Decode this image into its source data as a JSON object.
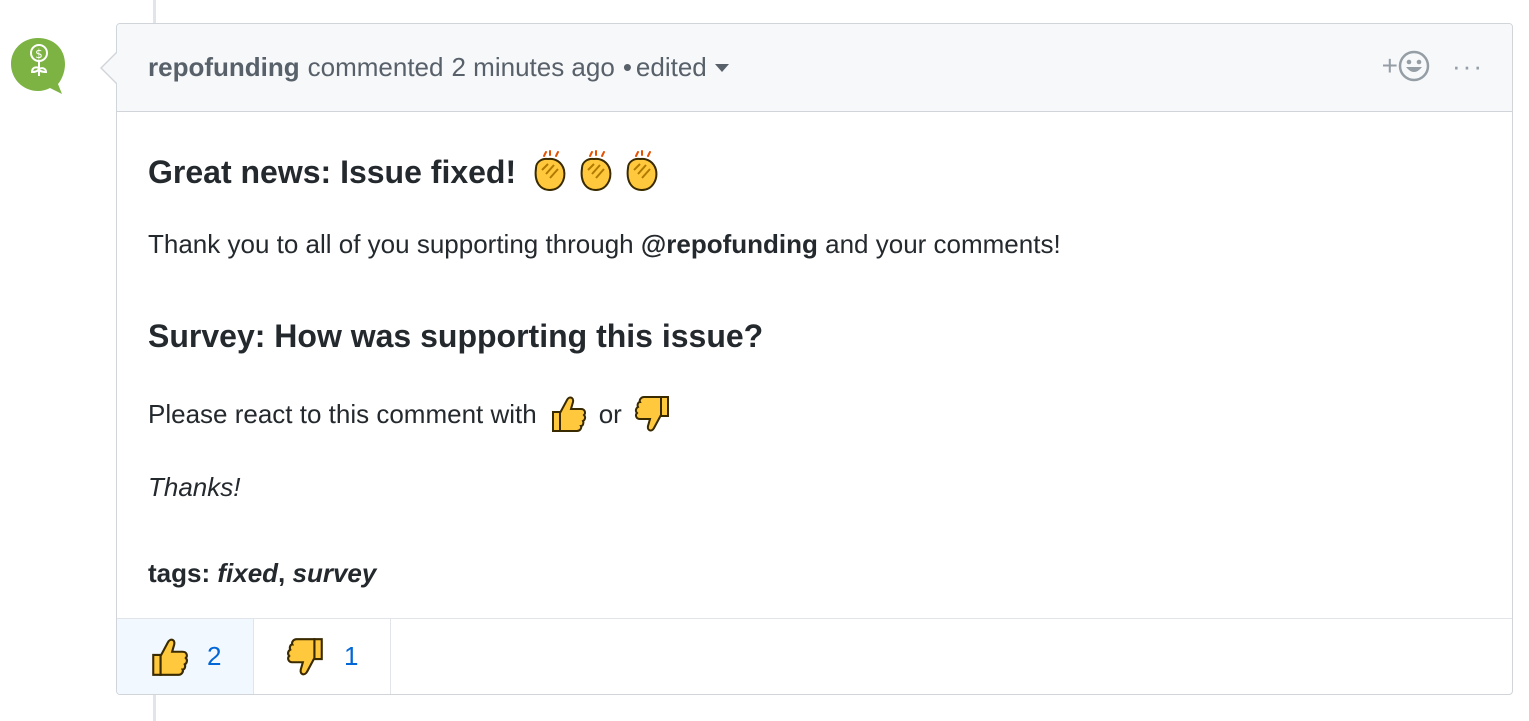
{
  "comment": {
    "author": "repofunding",
    "action": "commented",
    "time": "2 minutes ago",
    "separator": "•",
    "edited_label": "edited",
    "add_reaction_label": "+",
    "more_label": "···"
  },
  "body": {
    "heading": "Great news: Issue fixed!",
    "thanks_pre": "Thank you to all of you supporting through",
    "mention": "@repofunding",
    "thanks_post": "and your comments!",
    "survey_heading": "Survey: How was supporting this issue?",
    "react_pre": "Please react to this comment with",
    "react_or": "or",
    "signoff": "Thanks!",
    "tags_label": "tags:",
    "tag1": "fixed",
    "tag_sep": ",",
    "tag2": "survey"
  },
  "reactions": [
    {
      "emoji": "thumbs-up",
      "count": "2",
      "active": true
    },
    {
      "emoji": "thumbs-down",
      "count": "1",
      "active": false
    }
  ],
  "colors": {
    "avatar_green": "#7cb342",
    "link_blue": "#0366d6",
    "emoji_yellow": "#ffc83d"
  }
}
